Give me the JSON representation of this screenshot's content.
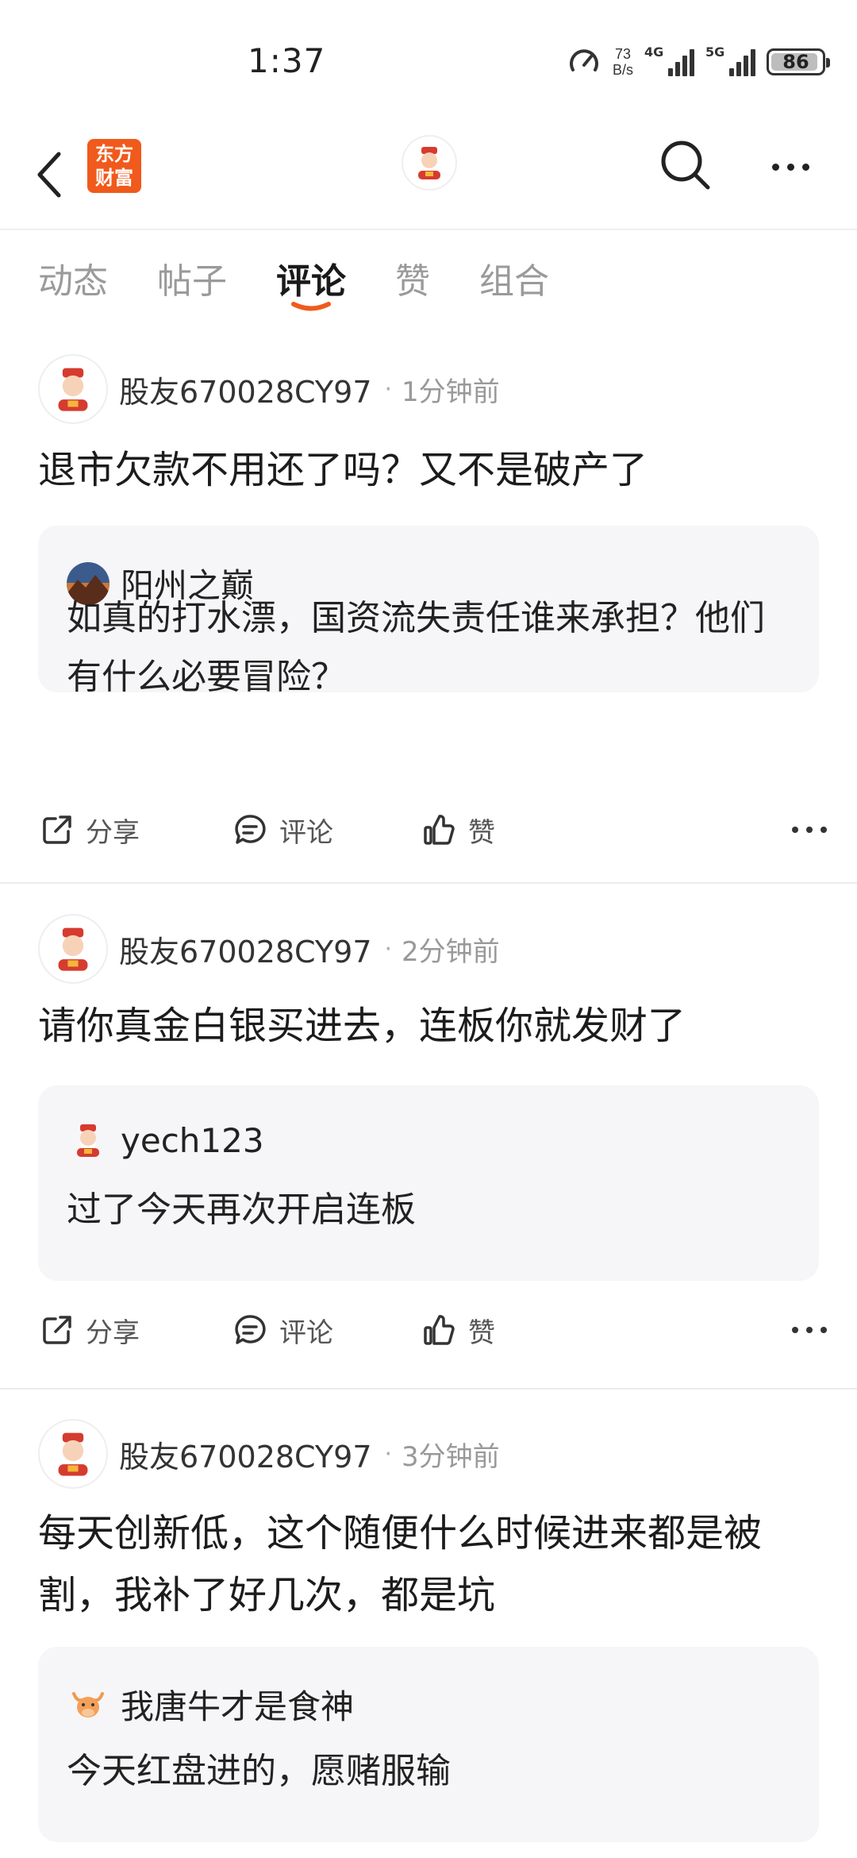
{
  "status_bar": {
    "time": "1:37",
    "net_speed_value": "73",
    "net_speed_unit": "B/s",
    "sig1": "4G",
    "sig2": "5G",
    "battery": "86"
  },
  "header": {
    "brand_line1": "东方",
    "brand_line2": "财富",
    "brand_color": "#f05a1c"
  },
  "tabs": [
    {
      "label": "动态",
      "active": false
    },
    {
      "label": "帖子",
      "active": false
    },
    {
      "label": "评论",
      "active": true
    },
    {
      "label": "赞",
      "active": false
    },
    {
      "label": "组合",
      "active": false
    }
  ],
  "accent_color": "#f05a1c",
  "posts": [
    {
      "user": "股友670028CY97",
      "time": "1分钟前",
      "text": "退市欠款不用还了吗？又不是破产了",
      "quote": {
        "user": "阳州之巅",
        "avatar_icon": "mountain-sunset-avatar",
        "text": "如真的打水漂，国资流失责任谁来承担？他们有什么必要冒险？"
      },
      "actions": {
        "share": "分享",
        "comment": "评论",
        "like": "赞"
      }
    },
    {
      "user": "股友670028CY97",
      "time": "2分钟前",
      "text": "请你真金白银买进去，连板你就发财了",
      "quote": {
        "user": "yech123",
        "avatar_icon": "god-of-wealth-avatar",
        "text": "过了今天再次开启连板"
      },
      "actions": {
        "share": "分享",
        "comment": "评论",
        "like": "赞"
      }
    },
    {
      "user": "股友670028CY97",
      "time": "3分钟前",
      "text": "每天创新低，这个随便什么时候进来都是被割，我补了好几次，都是坑",
      "quote": {
        "user": "我唐牛才是食神",
        "avatar_icon": "bull-avatar",
        "text": "今天红盘进的，愿赌服输"
      },
      "actions": {
        "share": "分享",
        "comment": "评论",
        "like": "赞"
      }
    }
  ]
}
